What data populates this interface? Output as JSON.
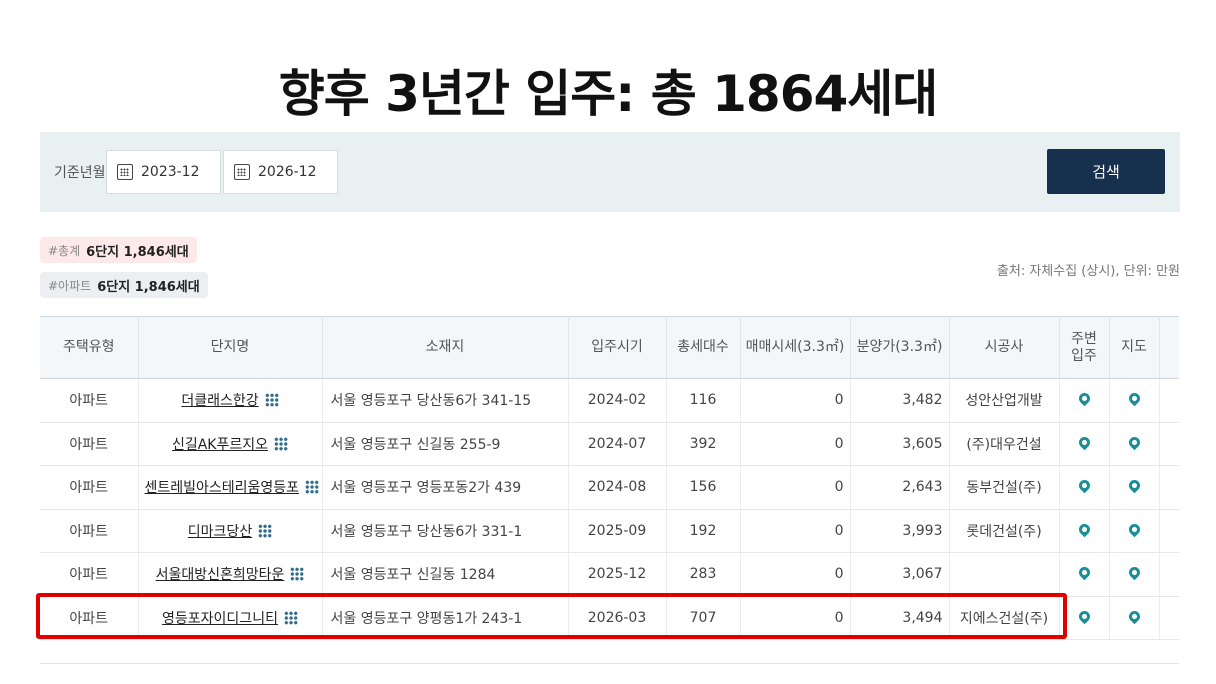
{
  "headline": "향후 3년간 입주: 총 1864세대",
  "filter": {
    "label": "기준년월",
    "start": "2023-12",
    "end": "2026-12",
    "search_label": "검색"
  },
  "tags": {
    "total_hash": "#총계",
    "total_value": "6단지 1,846세대",
    "apt_hash": "#아파트",
    "apt_value": "6단지 1,846세대"
  },
  "source": "출처: 자체수집 (상시), 단위: 만원",
  "table": {
    "headers": {
      "type": "주택유형",
      "name": "단지명",
      "address": "소재지",
      "move_in": "입주시기",
      "households": "총세대수",
      "trade_price": "매매시세(3.3㎡)",
      "sale_price": "분양가(3.3㎡)",
      "builder": "시공사",
      "nearby": "주변\n입주",
      "map": "지도"
    },
    "rows": [
      {
        "type": "아파트",
        "name": "더클래스한강",
        "address": "서울 영등포구 당산동6가 341-15",
        "move_in": "2024-02",
        "households": "116",
        "trade_price": "0",
        "sale_price": "3,482",
        "builder": "성안산업개발"
      },
      {
        "type": "아파트",
        "name": "신길AK푸르지오",
        "address": "서울 영등포구 신길동 255-9",
        "move_in": "2024-07",
        "households": "392",
        "trade_price": "0",
        "sale_price": "3,605",
        "builder": "(주)대우건설"
      },
      {
        "type": "아파트",
        "name": "센트레빌아스테리움영등포",
        "address": "서울 영등포구 영등포동2가 439",
        "move_in": "2024-08",
        "households": "156",
        "trade_price": "0",
        "sale_price": "2,643",
        "builder": "동부건설(주)"
      },
      {
        "type": "아파트",
        "name": "디마크당산",
        "address": "서울 영등포구 당산동6가 331-1",
        "move_in": "2025-09",
        "households": "192",
        "trade_price": "0",
        "sale_price": "3,993",
        "builder": "롯데건설(주)"
      },
      {
        "type": "아파트",
        "name": "서울대방신혼희망타운",
        "address": "서울 영등포구 신길동 1284",
        "move_in": "2025-12",
        "households": "283",
        "trade_price": "0",
        "sale_price": "3,067",
        "builder": ""
      },
      {
        "type": "아파트",
        "name": "영등포자이디그니티",
        "address": "서울 영등포구 양평동1가 243-1",
        "move_in": "2026-03",
        "households": "707",
        "trade_price": "0",
        "sale_price": "3,494",
        "builder": "지에스건설(주)"
      }
    ]
  },
  "colors": {
    "accent": "#16304d",
    "pin": "#1a8e96",
    "highlight": "#e10000"
  }
}
